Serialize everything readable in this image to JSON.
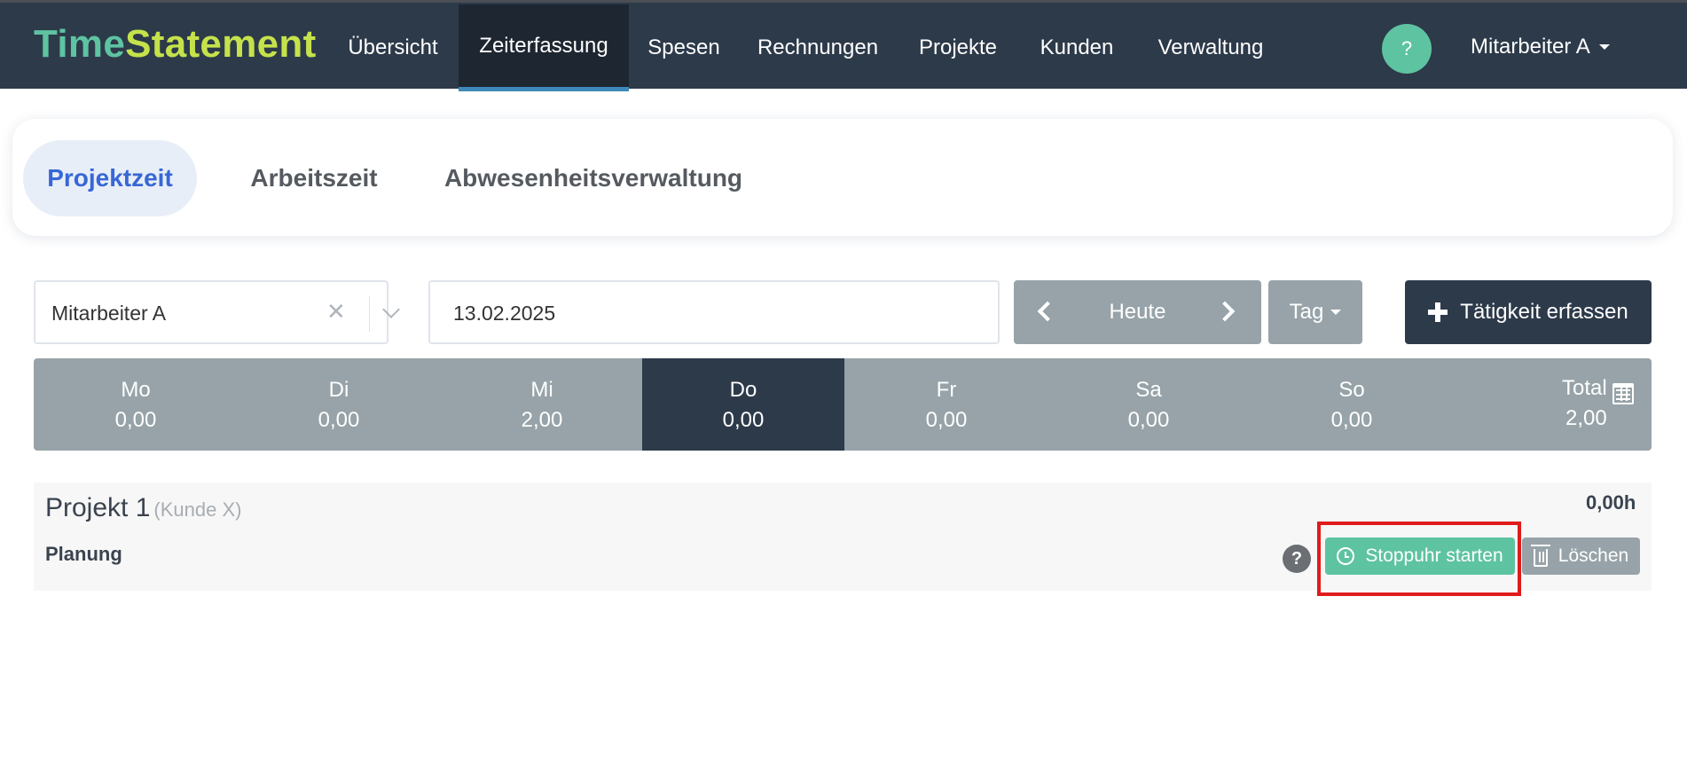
{
  "brand": {
    "part1": "Time",
    "part2": "Statement"
  },
  "nav": {
    "items": [
      {
        "label": "Übersicht"
      },
      {
        "label": "Zeiterfassung",
        "active": true
      },
      {
        "label": "Spesen"
      },
      {
        "label": "Rechnungen"
      },
      {
        "label": "Projekte"
      },
      {
        "label": "Kunden"
      },
      {
        "label": "Verwaltung"
      }
    ],
    "help": "?",
    "user": "Mitarbeiter A"
  },
  "subtabs": [
    {
      "label": "Projektzeit",
      "active": true
    },
    {
      "label": "Arbeitszeit"
    },
    {
      "label": "Abwesenheitsverwaltung"
    }
  ],
  "controls": {
    "employee": "Mitarbeiter A",
    "date": "13.02.2025",
    "today": "Heute",
    "period": "Tag",
    "add": "Tätigkeit erfassen"
  },
  "week": {
    "days": [
      {
        "name": "Mo",
        "value": "0,00"
      },
      {
        "name": "Di",
        "value": "0,00"
      },
      {
        "name": "Mi",
        "value": "2,00"
      },
      {
        "name": "Do",
        "value": "0,00",
        "active": true
      },
      {
        "name": "Fr",
        "value": "0,00"
      },
      {
        "name": "Sa",
        "value": "0,00"
      },
      {
        "name": "So",
        "value": "0,00"
      }
    ],
    "total_label": "Total",
    "total_value": "2,00"
  },
  "entry": {
    "project": "Projekt 1",
    "client": "(Kunde X)",
    "task": "Planung",
    "hours": "0,00h",
    "help": "?",
    "stopwatch": "Stoppuhr starten",
    "delete": "Löschen"
  },
  "colors": {
    "nav_bg": "#2d3a4a",
    "accent_green": "#5ec3a1",
    "brand_lime": "#c5e24b",
    "gray_button": "#97a3a8",
    "active_tab": "#3767d6",
    "highlight": "#e01b1b"
  }
}
